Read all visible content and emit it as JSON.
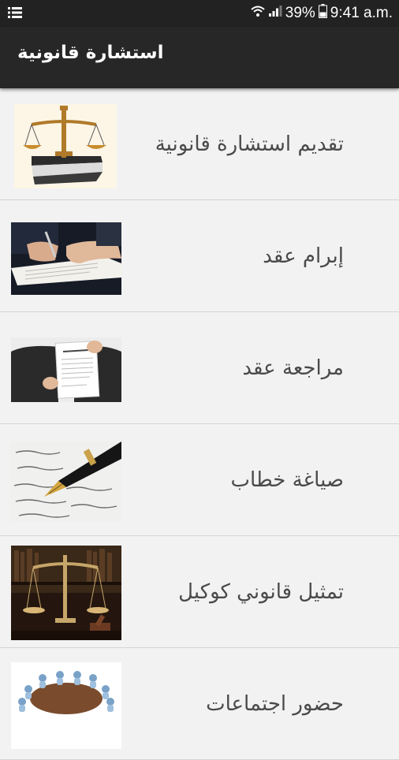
{
  "status_bar": {
    "battery": "39%",
    "time": "9:41 a.m."
  },
  "app_bar": {
    "title": "استشارة قانونية"
  },
  "items": [
    {
      "label": "تقديم استشارة قانونية",
      "icon": "scales-book-icon"
    },
    {
      "label": "إبرام عقد",
      "icon": "signing-contract-icon"
    },
    {
      "label": "مراجعة عقد",
      "icon": "reviewing-document-icon"
    },
    {
      "label": "صياغة خطاب",
      "icon": "fountain-pen-icon"
    },
    {
      "label": "تمثيل قانوني كوكيل",
      "icon": "justice-scales-gavel-icon"
    },
    {
      "label": "حضور اجتماعات",
      "icon": "meeting-table-icon"
    }
  ]
}
